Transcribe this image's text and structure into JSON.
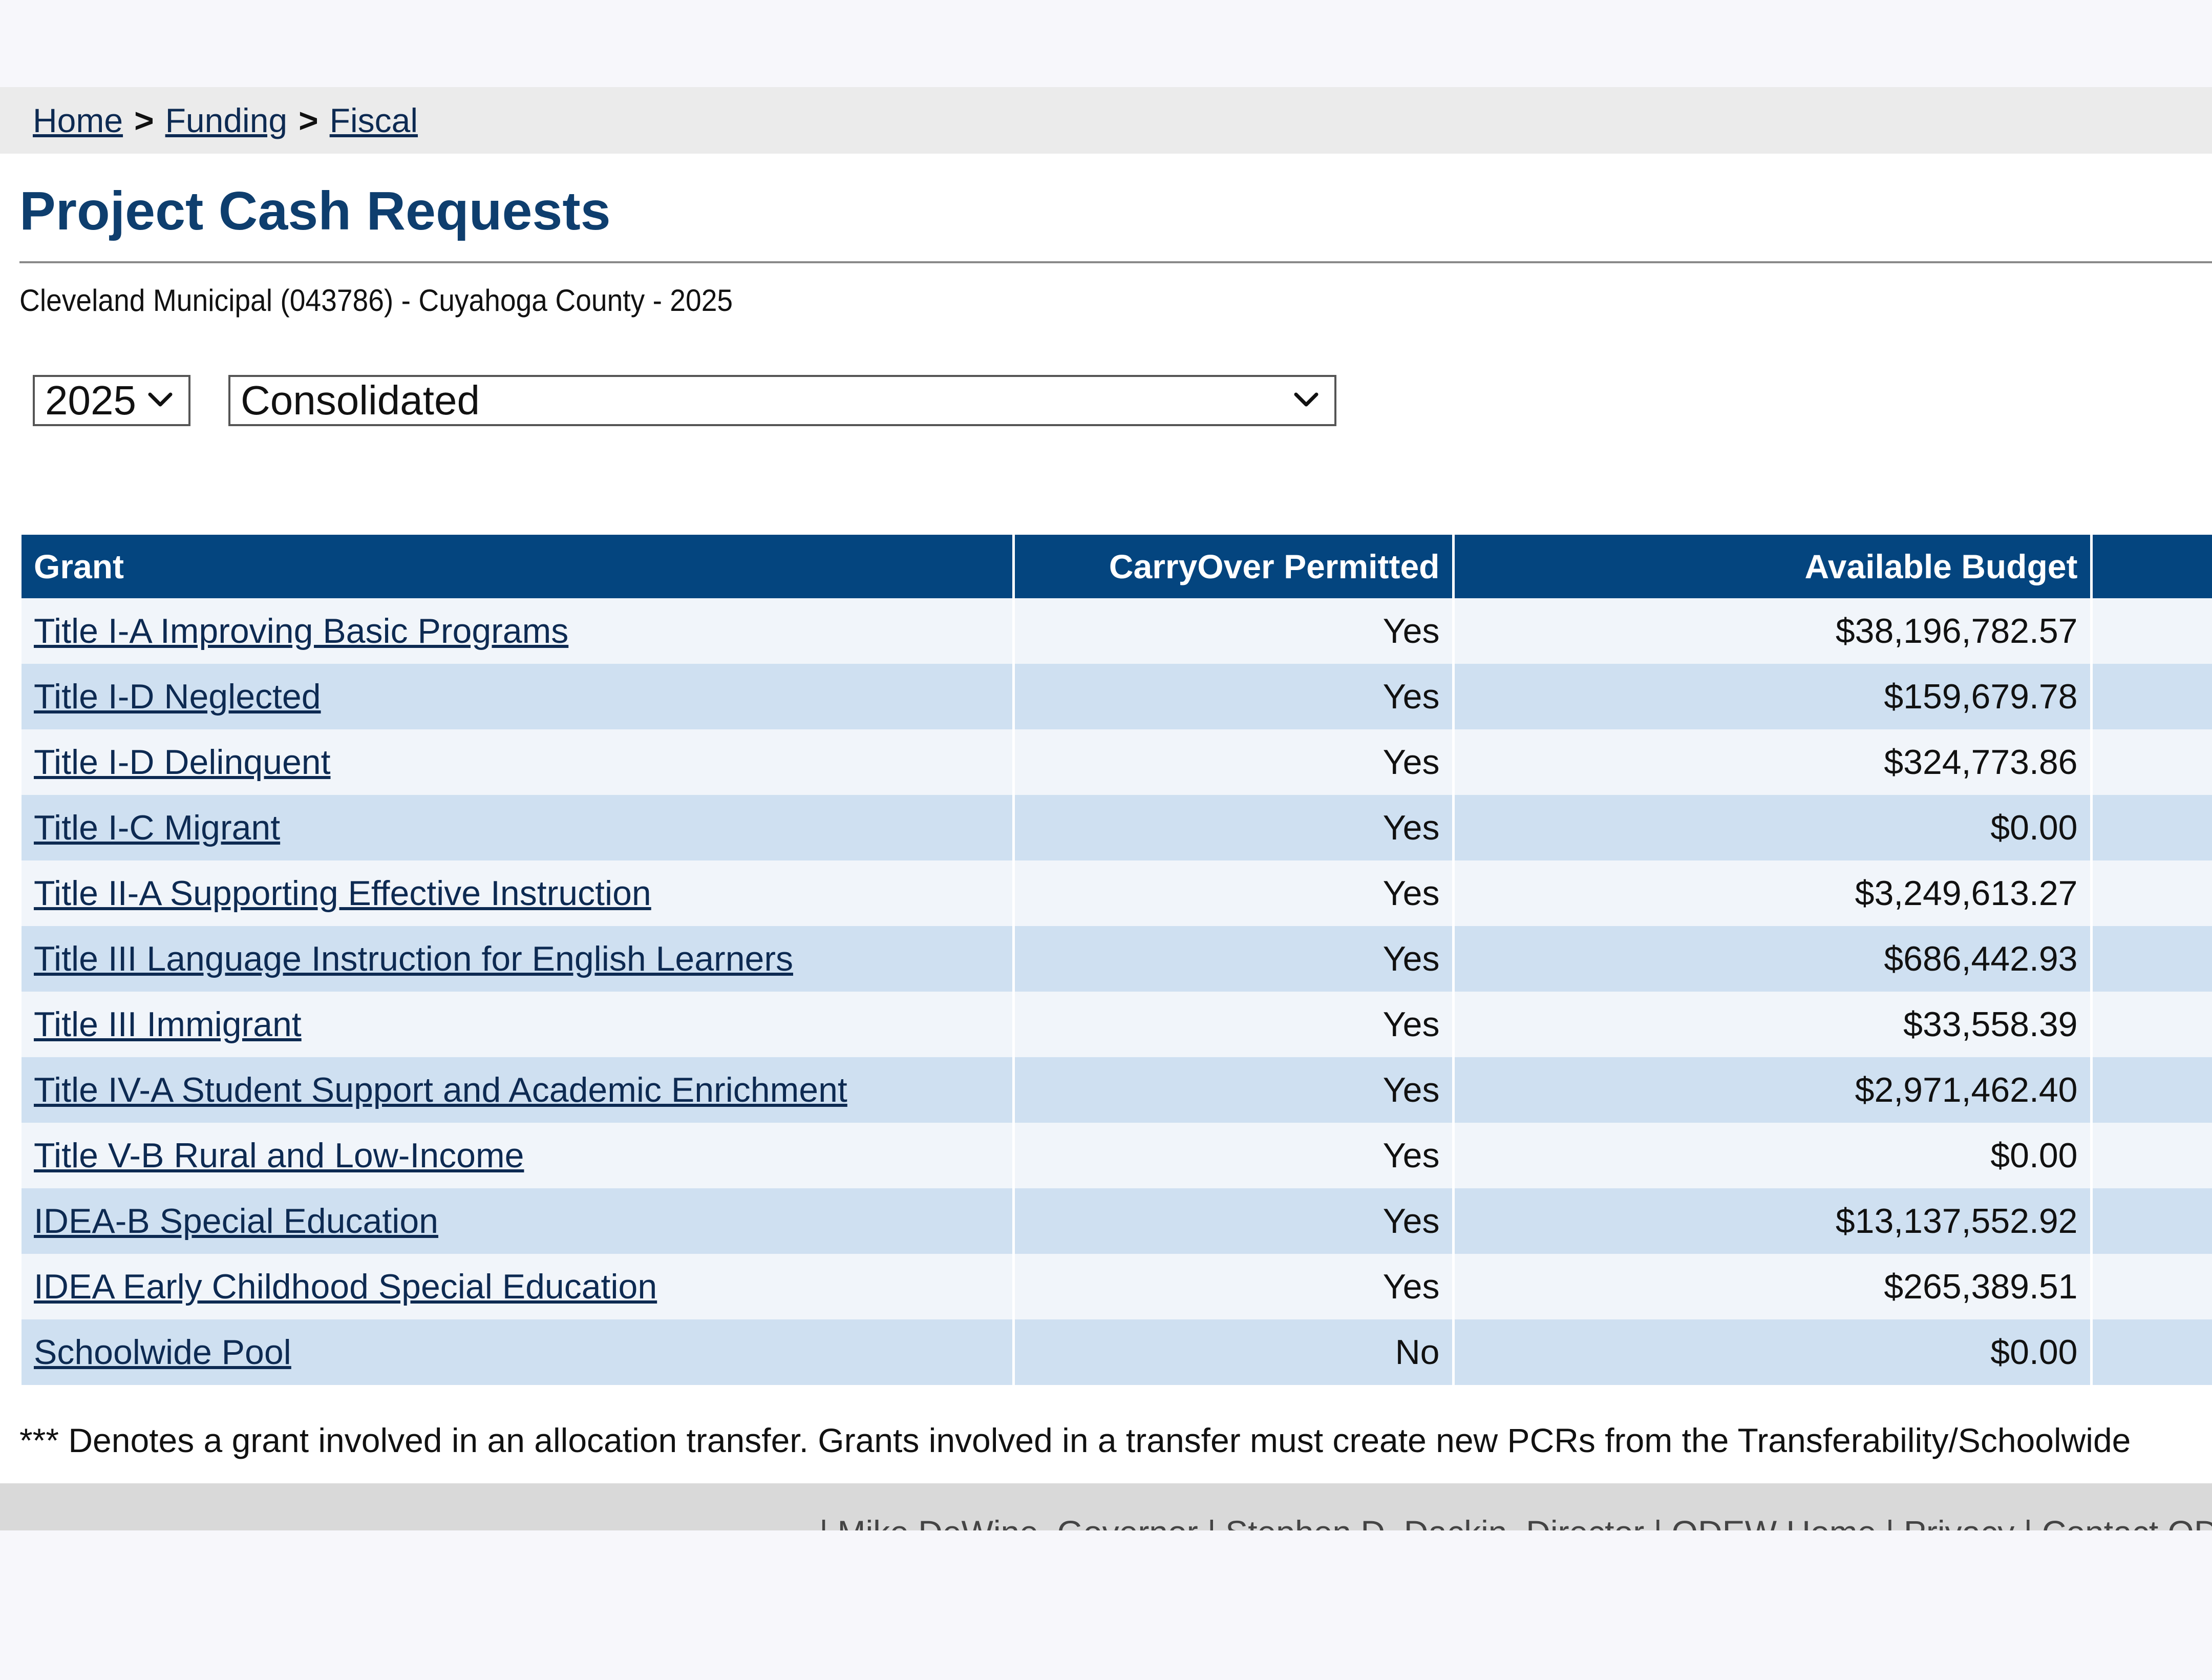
{
  "breadcrumb": {
    "items": [
      "Home",
      "Funding",
      "Fiscal"
    ],
    "separator": ">"
  },
  "page": {
    "title": "Project Cash Requests",
    "district_line": "Cleveland Municipal (043786) - Cuyahoga County - 2025"
  },
  "filters": {
    "year": "2025",
    "program": "Consolidated"
  },
  "table": {
    "headers": {
      "grant": "Grant",
      "carryover": "CarryOver Permitted",
      "budget": "Available Budget"
    },
    "rows": [
      {
        "grant": "Title I-A Improving Basic Programs",
        "carryover": "Yes",
        "budget": "$38,196,782.57"
      },
      {
        "grant": "Title I-D Neglected",
        "carryover": "Yes",
        "budget": "$159,679.78"
      },
      {
        "grant": "Title I-D Delinquent",
        "carryover": "Yes",
        "budget": "$324,773.86"
      },
      {
        "grant": "Title I-C Migrant",
        "carryover": "Yes",
        "budget": "$0.00"
      },
      {
        "grant": "Title II-A Supporting Effective Instruction",
        "carryover": "Yes",
        "budget": "$3,249,613.27"
      },
      {
        "grant": "Title III Language Instruction for English Learners",
        "carryover": "Yes",
        "budget": "$686,442.93"
      },
      {
        "grant": "Title III Immigrant",
        "carryover": "Yes",
        "budget": "$33,558.39"
      },
      {
        "grant": "Title IV-A Student Support and Academic Enrichment",
        "carryover": "Yes",
        "budget": "$2,971,462.40"
      },
      {
        "grant": "Title V-B Rural and Low-Income",
        "carryover": "Yes",
        "budget": "$0.00"
      },
      {
        "grant": "IDEA-B Special Education",
        "carryover": "Yes",
        "budget": "$13,137,552.92"
      },
      {
        "grant": "IDEA Early Childhood Special Education",
        "carryover": "Yes",
        "budget": "$265,389.51"
      },
      {
        "grant": "Schoolwide Pool",
        "carryover": "No",
        "budget": "$0.00"
      }
    ]
  },
  "footnote": "*** Denotes a grant involved in an allocation transfer. Grants involved in a transfer must create new PCRs from the Transferability/Schoolwide",
  "footer": {
    "links": [
      "| Mike DeWine, Governor",
      "| Stephen D. Dackin, Director",
      "| ODEW Home",
      "| Privacy",
      "| Contact ODEW"
    ]
  },
  "colors": {
    "header_bg": "#04457f",
    "title": "#0e3e6e",
    "row_even": "#cfe0f1",
    "row_odd": "#f1f5fa",
    "link": "#0d2a52"
  }
}
